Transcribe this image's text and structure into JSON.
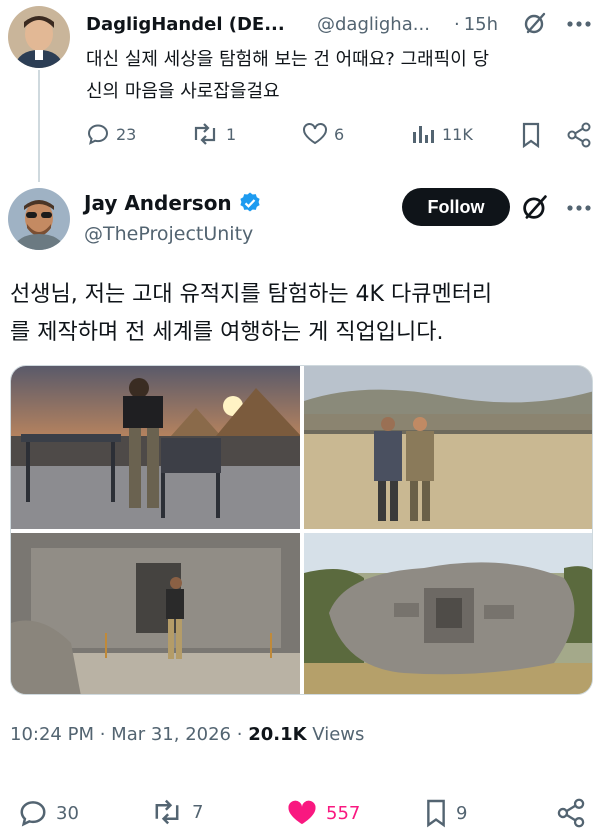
{
  "reply": {
    "display_name": "DagligHandel (DE...",
    "handle": "@daglighа...",
    "time": "15h",
    "text_line1": "대신 실제 세상을 탐험해 보는 건 어때요? 그래픽이 당",
    "text_line2": "신의 마음을 사로잡을걸요",
    "stats": {
      "replies": "23",
      "reposts": "1",
      "likes": "6",
      "views": "11K"
    }
  },
  "post": {
    "display_name": "Jay Anderson",
    "handle": "@TheProjectUnity",
    "follow_label": "Follow",
    "text_line1": "선생님, 저는 고대 유적지를 탐험하는 4K 다큐멘터리",
    "text_line2": "를 제작하며 전 세계를 여행하는 게 직업입니다.",
    "time": "10:24 PM",
    "date": "Mar 31, 2026",
    "views_count": "20.1K",
    "views_label": "Views",
    "stats": {
      "replies": "30",
      "reposts": "7",
      "likes": "557",
      "bookmarks": "9"
    }
  },
  "colors": {
    "like": "#f91880",
    "verified": "#1d9bf0",
    "muted": "#536471"
  },
  "icons": [
    "reply-icon",
    "repost-icon",
    "like-icon",
    "views-icon",
    "bookmark-icon",
    "share-icon",
    "grok-icon",
    "more-icon",
    "verified-badge-icon"
  ]
}
